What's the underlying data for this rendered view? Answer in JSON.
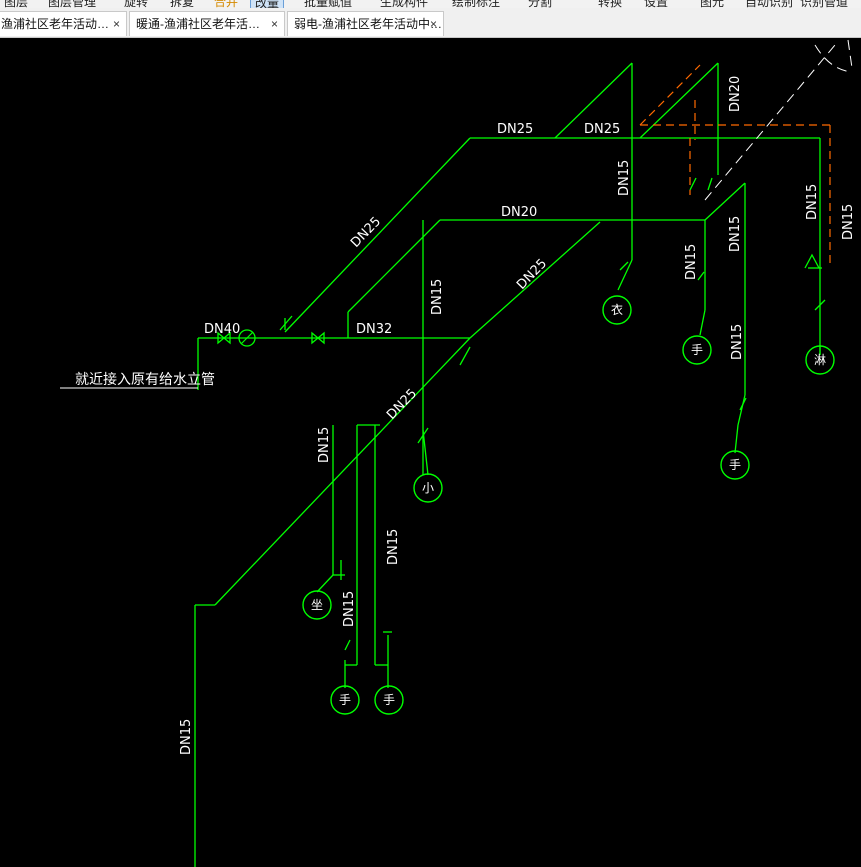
{
  "toolbar": {
    "items": [
      "图层",
      "图层管理",
      "旋转",
      "拆复",
      "合并",
      "改量",
      "批量赋值",
      "生成构件",
      "绘制标注",
      "分割",
      "转换",
      "设置",
      "图元",
      "自动识别",
      "识别管道"
    ],
    "active_index": 5
  },
  "tabs": [
    {
      "label": "渔浦社区老年活动…",
      "close": "×"
    },
    {
      "label": "暖通-渔浦社区老年活…",
      "close": "×"
    },
    {
      "label": "弱电-渔浦社区老年活动中…",
      "close": "×"
    }
  ],
  "drawing": {
    "colors": {
      "pipe": "#00ff00",
      "hidden_line": "#ff6a00",
      "annotation": "#ffffff",
      "background": "#000000"
    },
    "pipe_labels": {
      "dn25_top_left": "DN25",
      "dn25_top_right": "DN25",
      "dn25_diag_upper": "DN25",
      "dn20_vertical_top": "DN20",
      "dn15_riser_a": "DN15",
      "dn20_mid": "DN20",
      "dn15_riser_b": "DN15",
      "dn15_right_a": "DN15",
      "dn15_right_b": "DN15",
      "dn25_diag_mid": "DN25",
      "dn40_inlet": "DN40",
      "dn32_main": "DN32",
      "dn15_center": "DN15",
      "dn15_right_c": "DN15",
      "dn25_diag_lower": "DN25",
      "dn15_left_riser": "DN15",
      "dn15_branch_a": "DN15",
      "dn15_branch_b": "DN15",
      "dn15_bottom_riser": "DN15"
    },
    "inlet_note": "就近接入原有给水立管",
    "fixture_labels": {
      "fixture_1": "衣",
      "fixture_2": "手",
      "fixture_3": "淋",
      "fixture_4": "手",
      "fixture_5": "小",
      "fixture_6": "坐",
      "fixture_7": "手",
      "fixture_8": "手"
    }
  }
}
